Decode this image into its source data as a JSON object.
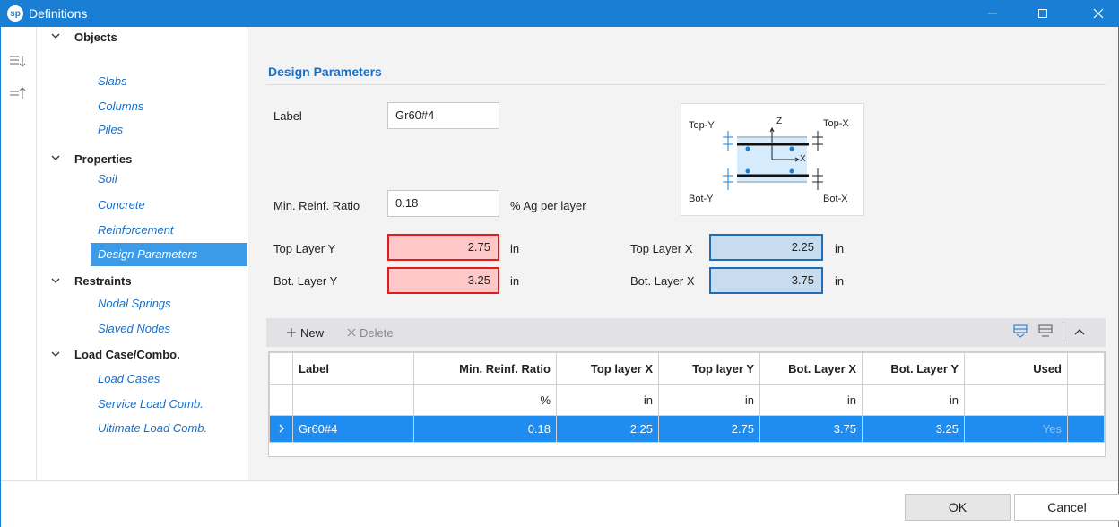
{
  "window": {
    "title": "Definitions",
    "logo": "sp"
  },
  "sidebar": {
    "groups": [
      {
        "label": "Objects",
        "items": [
          "Slabs",
          "Columns",
          "Piles"
        ]
      },
      {
        "label": "Properties",
        "items": [
          "Soil",
          "Concrete",
          "Reinforcement",
          "Design Parameters"
        ]
      },
      {
        "label": "Restraints",
        "items": [
          "Nodal Springs",
          "Slaved Nodes"
        ]
      },
      {
        "label": "Load Case/Combo.",
        "items": [
          "Load Cases",
          "Service Load Comb.",
          "Ultimate Load Comb."
        ]
      }
    ],
    "selected": "Design Parameters"
  },
  "form": {
    "section_title": "Design Parameters",
    "label_label": "Label",
    "label_value": "Gr60#4",
    "min_reinf_label": "Min. Reinf. Ratio",
    "min_reinf_value": "0.18",
    "min_reinf_unit": "%  Ag per layer",
    "top_layer_y_label": "Top Layer Y",
    "top_layer_y_value": "2.75",
    "bot_layer_y_label": "Bot. Layer Y",
    "bot_layer_y_value": "3.25",
    "top_layer_x_label": "Top Layer X",
    "top_layer_x_value": "2.25",
    "bot_layer_x_label": "Bot. Layer X",
    "bot_layer_x_value": "3.75",
    "unit": "in"
  },
  "diagram": {
    "top_y": "Top-Y",
    "top_x": "Top-X",
    "bot_y": "Bot-Y",
    "bot_x": "Bot-X",
    "z": "Z",
    "x": "X"
  },
  "toolbar": {
    "new_label": "New",
    "delete_label": "Delete"
  },
  "grid": {
    "headers": [
      "Label",
      "Min. Reinf. Ratio",
      "Top layer X",
      "Top layer Y",
      "Bot. Layer X",
      "Bot. Layer Y",
      "Used"
    ],
    "units": [
      "",
      "%",
      "in",
      "in",
      "in",
      "in",
      ""
    ],
    "rows": [
      {
        "label": "Gr60#4",
        "ratio": "0.18",
        "top_x": "2.25",
        "top_y": "2.75",
        "bot_x": "3.75",
        "bot_y": "3.25",
        "used": "Yes"
      }
    ]
  },
  "footer": {
    "ok_label": "OK",
    "cancel_label": "Cancel"
  }
}
